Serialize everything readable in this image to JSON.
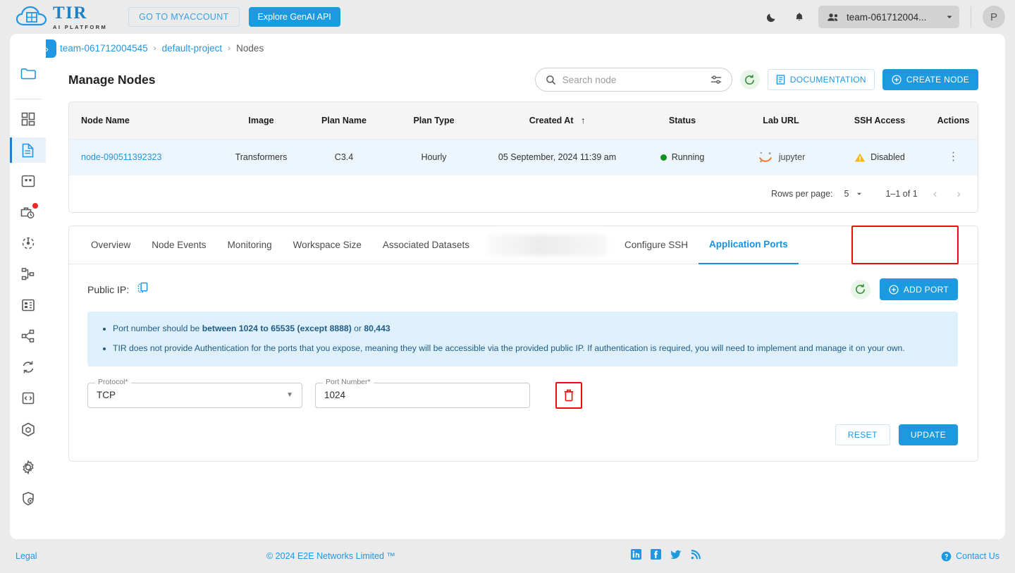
{
  "header": {
    "logo_title": "TIR",
    "logo_subtitle": "AI PLATFORM",
    "myaccount_label": "GO TO MYACCOUNT",
    "genai_label": "Explore GenAI API",
    "team_name": "team-061712004...",
    "avatar_initial": "P",
    "icons": {
      "dark_mode": "moon-icon",
      "notifications": "bell-icon"
    }
  },
  "breadcrumb": {
    "collapse_glyph": "»",
    "items": [
      {
        "label": "team-061712004545",
        "link": true
      },
      {
        "label": "default-project",
        "link": true
      },
      {
        "label": "Nodes",
        "link": false
      }
    ],
    "separator": "›"
  },
  "page": {
    "title": "Manage Nodes",
    "search_placeholder": "Search node",
    "search_value": "",
    "documentation_label": "DOCUMENTATION",
    "create_node_label": "CREATE NODE"
  },
  "table": {
    "columns": [
      "Node Name",
      "Image",
      "Plan Name",
      "Plan Type",
      "Created At",
      "Status",
      "Lab URL",
      "SSH Access",
      "Actions"
    ],
    "sort_column": "Created At",
    "sort_arrow": "↑",
    "rows": [
      {
        "node_name": "node-090511392323",
        "image": "Transformers",
        "plan_name": "C3.4",
        "plan_type": "Hourly",
        "created_at": "05 September, 2024 11:39 am",
        "status": "Running",
        "lab_url": "jupyter",
        "ssh_access": "Disabled",
        "actions": "⋮"
      }
    ],
    "pagination": {
      "rows_per_page_label": "Rows per page:",
      "rows_per_page_value": "5",
      "range_label": "1–1 of 1",
      "prev": "‹",
      "next": "›"
    }
  },
  "tabs": [
    {
      "label": "Overview",
      "active": false,
      "blurred": false
    },
    {
      "label": "Node Events",
      "active": false,
      "blurred": false
    },
    {
      "label": "Monitoring",
      "active": false,
      "blurred": false
    },
    {
      "label": "Workspace Size",
      "active": false,
      "blurred": false
    },
    {
      "label": "Associated Datasets",
      "active": false,
      "blurred": false
    },
    {
      "label": "",
      "active": false,
      "blurred": true
    },
    {
      "label": "Configure SSH",
      "active": false,
      "blurred": false
    },
    {
      "label": "Application Ports",
      "active": true,
      "blurred": false
    }
  ],
  "ports_panel": {
    "public_ip_label": "Public IP:",
    "public_ip_value": "",
    "copy_icon": "copy-icon",
    "add_port_label": "ADD PORT",
    "notices": [
      "Port number should be between 1024 to 65535 (except 8888) or 80,443",
      "TIR does not provide Authentication for the ports that you expose, meaning they will be accessible via the provided public IP. If authentication is required, you will need to implement and manage it on your own."
    ],
    "notice_1_parts": {
      "pre": "Port number should be ",
      "bold1": "between 1024 to 65535 (except 8888)",
      "mid": " or ",
      "bold2": "80,443"
    },
    "form": {
      "protocol_label": "Protocol",
      "protocol_required": "*",
      "protocol_value": "TCP",
      "port_label": "Port Number",
      "port_required": "*",
      "port_value": "1024",
      "delete_icon": "trash-icon"
    },
    "reset_label": "RESET",
    "update_label": "UPDATE"
  },
  "sidebar": {
    "items": [
      {
        "name": "folder-icon",
        "active": false,
        "badge": false
      },
      {
        "name": "dashboard-grid-icon",
        "active": false,
        "badge": false
      },
      {
        "name": "document-icon",
        "active": true,
        "badge": false
      },
      {
        "name": "grid-box-icon",
        "active": false,
        "badge": false
      },
      {
        "name": "briefcase-clock-icon",
        "active": false,
        "badge": true
      },
      {
        "name": "hub-icon",
        "active": false,
        "badge": false
      },
      {
        "name": "sitemap-icon",
        "active": false,
        "badge": false
      },
      {
        "name": "server-rack-icon",
        "active": false,
        "badge": false
      },
      {
        "name": "share-nodes-icon",
        "active": false,
        "badge": false
      },
      {
        "name": "sync-icon",
        "active": false,
        "badge": false
      },
      {
        "name": "code-brackets-icon",
        "active": false,
        "badge": false
      },
      {
        "name": "cube-icon",
        "active": false,
        "badge": false
      }
    ],
    "bottom_items": [
      {
        "name": "gear-icon"
      },
      {
        "name": "shield-lock-icon"
      }
    ]
  },
  "footer": {
    "legal": "Legal",
    "copyright": "© 2024 E2E Networks Limited ™",
    "social": [
      "linkedin-icon",
      "facebook-icon",
      "twitter-icon",
      "rss-icon"
    ],
    "contact": "Contact Us"
  },
  "colors": {
    "accent_blue": "#1b9ae0",
    "link_blue": "#2196e3",
    "status_green": "#119121",
    "warning_yellow": "#f4b719",
    "highlight_red": "#f00a0a",
    "notice_bg": "#def0fb"
  }
}
